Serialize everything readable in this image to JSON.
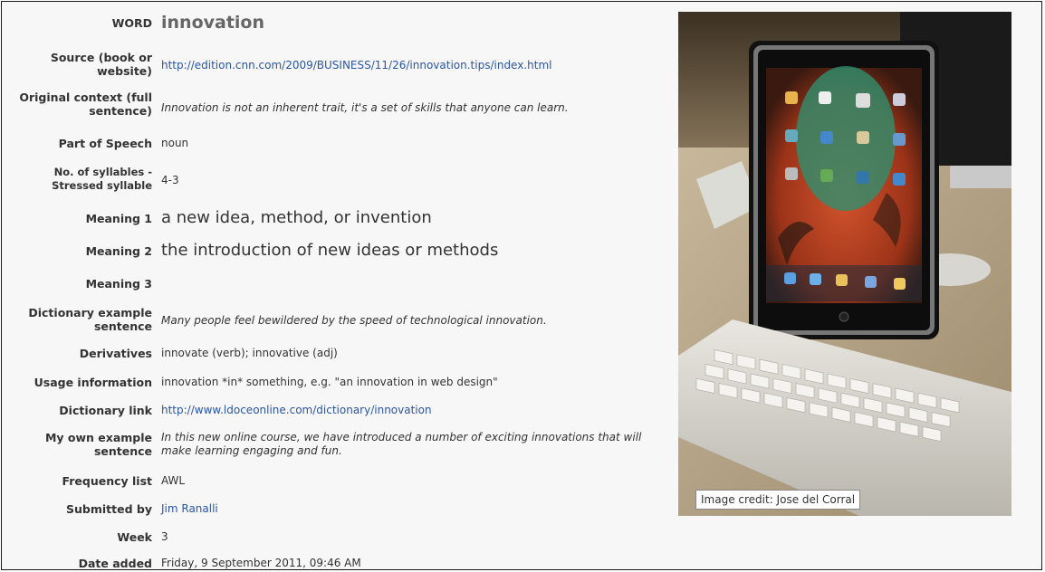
{
  "entry": {
    "word_label": "WORD",
    "word": "innovation",
    "rows": [
      {
        "label": "Source (book or website)",
        "value": "http://edition.cnn.com/2009/BUSINESS/11/26/innovation.tips/index.html"
      },
      {
        "label": "Original context (full sentence)",
        "value": "Innovation is not an inherent trait, it's a set of skills that anyone can learn."
      },
      {
        "label": "Part of Speech",
        "value": "noun"
      },
      {
        "label": "No. of syllables - Stressed syllable",
        "value": "4-3"
      },
      {
        "label": "Meaning 1",
        "value": "a new idea, method, or invention"
      },
      {
        "label": "Meaning 2",
        "value": "the introduction of new ideas or methods"
      },
      {
        "label": "Meaning 3",
        "value": ""
      },
      {
        "label": "Dictionary example sentence",
        "value": "Many people feel bewildered by the speed of technological innovation."
      },
      {
        "label": "Derivatives",
        "value": "innovate (verb); innovative (adj)"
      },
      {
        "label": "Usage information",
        "value": "innovation *in* something, e.g. \"an innovation in web design\""
      },
      {
        "label": "Dictionary link",
        "value": "http://www.ldoceonline.com/dictionary/innovation"
      },
      {
        "label": "My own example sentence",
        "value": "In this new online course, we have introduced a number of exciting innovations that will make learning engaging and fun."
      },
      {
        "label": "Frequency list",
        "value": "AWL"
      },
      {
        "label": "Submitted by",
        "value": "Jim Ranalli"
      },
      {
        "label": "Week",
        "value": "3"
      },
      {
        "label": "Date added",
        "value": "Friday, 9 September 2011, 09:46 AM"
      }
    ]
  },
  "image": {
    "credit": "Image credit: Jose del Corral"
  },
  "colors": {
    "link": "#2a55a6",
    "background": "#f7f7f7"
  }
}
